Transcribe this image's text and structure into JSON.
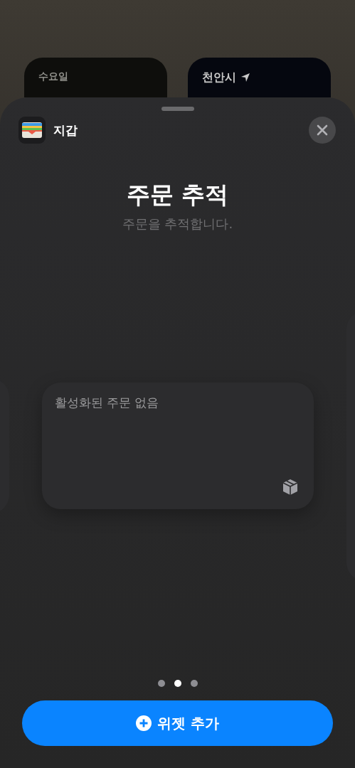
{
  "background_widgets": [
    {
      "kind": "calendar",
      "label": "수요일"
    },
    {
      "kind": "weather",
      "label": "천안시"
    }
  ],
  "sheet": {
    "app": {
      "name": "지갑"
    },
    "title": "주문 추적",
    "subtitle": "주문을 추적합니다.",
    "preview": {
      "message": "활성화된 주문 없음"
    },
    "pages": [
      {
        "selected": false
      },
      {
        "selected": true
      },
      {
        "selected": false
      }
    ],
    "add_button": {
      "label": "위젯 추가"
    }
  }
}
